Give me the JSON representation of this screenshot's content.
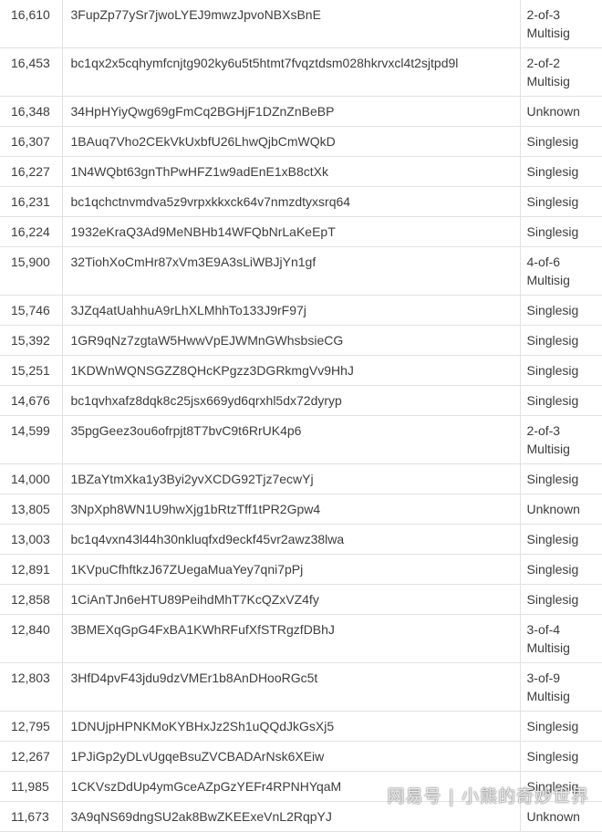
{
  "rows": [
    {
      "balance": "16,610",
      "address": "3FupZp77ySr7jwoLYEJ9mwzJpvoNBXsBnE",
      "type": "2-of-3 Multisig"
    },
    {
      "balance": "16,453",
      "address": "bc1qx2x5cqhymfcnjtg902ky6u5t5htmt7fvqztdsm028hkrvxcl4t2sjtpd9l",
      "type": "2-of-2 Multisig"
    },
    {
      "balance": "16,348",
      "address": "34HpHYiyQwg69gFmCq2BGHjF1DZnZnBeBP",
      "type": "Unknown"
    },
    {
      "balance": "16,307",
      "address": "1BAuq7Vho2CEkVkUxbfU26LhwQjbCmWQkD",
      "type": "Singlesig"
    },
    {
      "balance": "16,227",
      "address": "1N4WQbt63gnThPwHFZ1w9adEnE1xB8ctXk",
      "type": "Singlesig"
    },
    {
      "balance": "16,231",
      "address": "bc1qchctnvmdva5z9vrpxkkxck64v7nmzdtyxsrq64",
      "type": "Singlesig"
    },
    {
      "balance": "16,224",
      "address": "1932eKraQ3Ad9MeNBHb14WFQbNrLaKeEpT",
      "type": "Singlesig"
    },
    {
      "balance": "15,900",
      "address": "32TiohXoCmHr87xVm3E9A3sLiWBJjYn1gf",
      "type": "4-of-6 Multisig"
    },
    {
      "balance": "15,746",
      "address": "3JZq4atUahhuA9rLhXLMhhTo133J9rF97j",
      "type": "Singlesig"
    },
    {
      "balance": "15,392",
      "address": "1GR9qNz7zgtaW5HwwVpEJWMnGWhsbsieCG",
      "type": "Singlesig"
    },
    {
      "balance": "15,251",
      "address": "1KDWnWQNSGZZ8QHcKPgzz3DGRkmgVv9HhJ",
      "type": "Singlesig"
    },
    {
      "balance": "14,676",
      "address": "bc1qvhxafz8dqk8c25jsx669yd6qrxhl5dx72dyryp",
      "type": "Singlesig"
    },
    {
      "balance": "14,599",
      "address": "35pgGeez3ou6ofrpjt8T7bvC9t6RrUK4p6",
      "type": "2-of-3 Multisig"
    },
    {
      "balance": "14,000",
      "address": "1BZaYtmXka1y3Byi2yvXCDG92Tjz7ecwYj",
      "type": "Singlesig"
    },
    {
      "balance": "13,805",
      "address": "3NpXph8WN1U9hwXjg1bRtzTff1tPR2Gpw4",
      "type": "Unknown"
    },
    {
      "balance": "13,003",
      "address": "bc1q4vxn43l44h30nkluqfxd9eckf45vr2awz38lwa",
      "type": "Singlesig"
    },
    {
      "balance": "12,891",
      "address": "1KVpuCfhftkzJ67ZUegaMuaYey7qni7pPj",
      "type": "Singlesig"
    },
    {
      "balance": "12,858",
      "address": "1CiAnTJn6eHTU89PeihdMhT7KcQZxVZ4fy",
      "type": "Singlesig"
    },
    {
      "balance": "12,840",
      "address": "3BMEXqGpG4FxBA1KWhRFufXfSTRgzfDBhJ",
      "type": "3-of-4 Multisig"
    },
    {
      "balance": "12,803",
      "address": "3HfD4pvF43jdu9dzVMEr1b8AnDHooRGc5t",
      "type": "3-of-9 Multisig"
    },
    {
      "balance": "12,795",
      "address": "1DNUjpHPNKMoKYBHxJz2Sh1uQQdJkGsXj5",
      "type": "Singlesig"
    },
    {
      "balance": "12,267",
      "address": "1PJiGp2yDLvUgqeBsuZVCBADArNsk6XEiw",
      "type": "Singlesig"
    },
    {
      "balance": "11,985",
      "address": "1CKVszDdUp4ymGceAZpGzYEFr4RPNHYqaM",
      "type": "Singlesig"
    },
    {
      "balance": "11,673",
      "address": "3A9qNS69dngSU2ak8BwZKEExeVnL2RqpYJ",
      "type": "Unknown"
    }
  ],
  "watermark": "网易号 | 小熊的奇妙世界"
}
